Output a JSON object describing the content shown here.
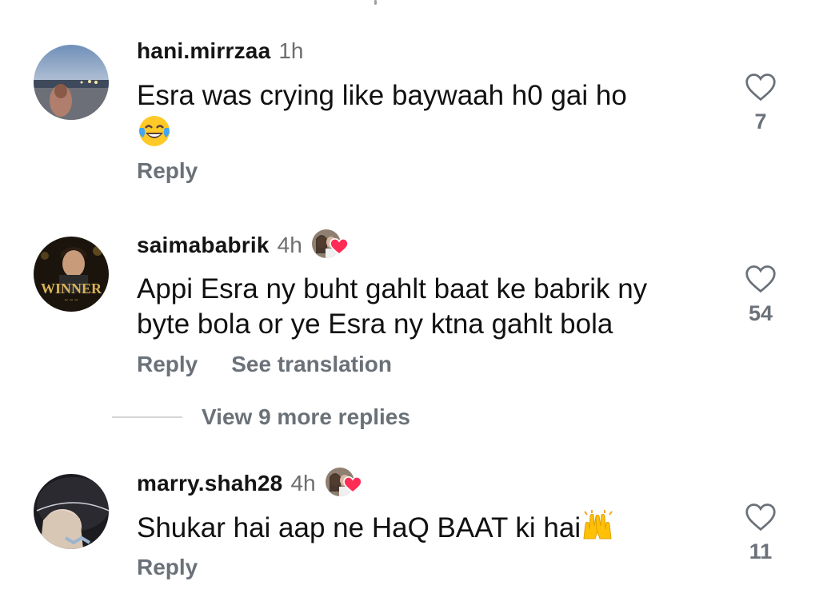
{
  "comments": [
    {
      "username": "hani.mirrzaa",
      "time": "1h",
      "text": "Esra was crying like baywaah h0 gai ho",
      "emoji": "face-with-tears-of-joy",
      "reply_label": "Reply",
      "likes": "7",
      "has_liked_badge": false
    },
    {
      "username": "saimababrik",
      "time": "4h",
      "text_line1": "Appi Esra ny buht gahlt baat ke babrik ny",
      "text_line2": "byte bola or ye Esra ny ktna gahlt bola",
      "reply_label": "Reply",
      "translate_label": "See translation",
      "likes": "54",
      "has_liked_badge": true,
      "avatar_text": "WINNER"
    },
    {
      "username": "marry.shah28",
      "time": "4h",
      "text": "Shukar hai aap ne HaQ BAAT ki hai",
      "emoji": "raising-hands",
      "reply_label": "Reply",
      "likes": "11",
      "has_liked_badge": true
    }
  ],
  "view_more": {
    "label": "View 9 more replies"
  },
  "colors": {
    "text": "#111111",
    "muted": "#6b7178",
    "heart_red": "#ff2d55",
    "like_outline": "#6b7178"
  }
}
